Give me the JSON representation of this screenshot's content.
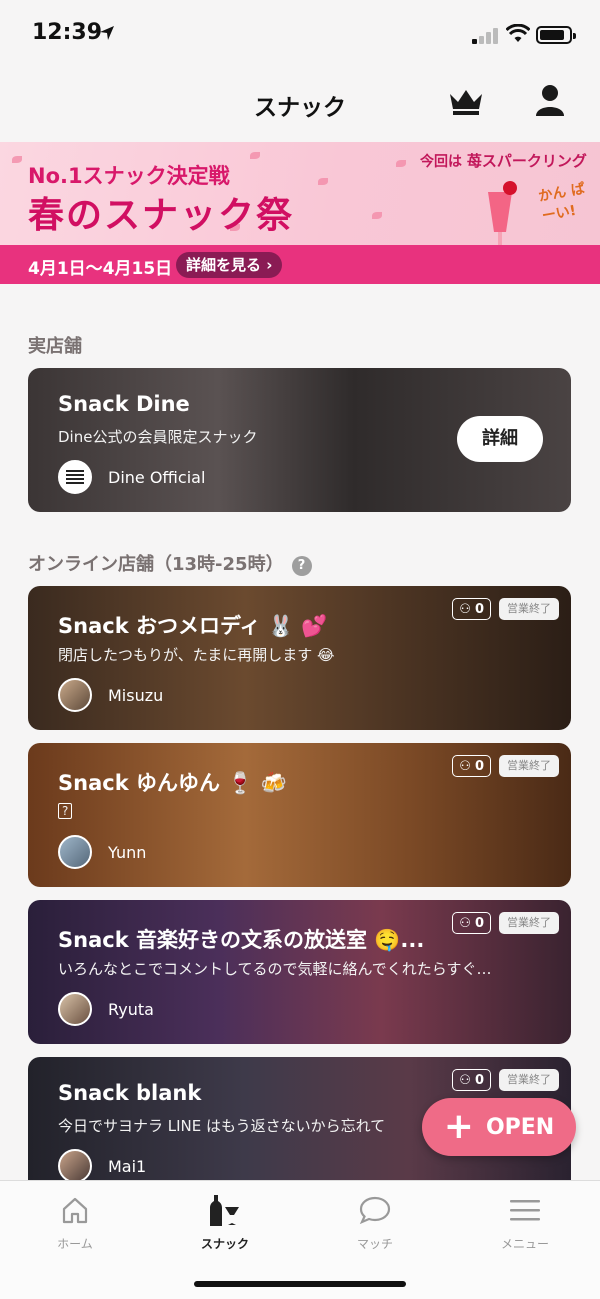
{
  "status_bar": {
    "time": "12:39"
  },
  "nav": {
    "title": "スナック"
  },
  "banner": {
    "subtitle": "No.1スナック決定戦",
    "title": "春のスナック祭",
    "dates": "4月1日〜4月15日",
    "detail_label": "詳細を見る ›",
    "promo_prefix": "今回は",
    "promo_item": "苺スパークリング",
    "kanpai": "かん ぱーい!"
  },
  "physical_section": {
    "label": "実店舗",
    "card": {
      "title": "Snack Dine",
      "description": "Dine公式の会員限定スナック",
      "host": "Dine Official",
      "detail_label": "詳細"
    }
  },
  "online_section": {
    "label": "オンライン店舗（13時-25時）",
    "help_icon": "?",
    "cards": [
      {
        "title": "Snack おつメロディ 🐰 💕",
        "description": "閉店したつもりが、たまに再開します 😂",
        "host": "Misuzu",
        "count": "0",
        "status": "営業終了"
      },
      {
        "title": "Snack ゆんゆん 🍷 🍻",
        "description": "?",
        "host": "Yunn",
        "count": "0",
        "status": "営業終了"
      },
      {
        "title": "Snack 音楽好きの文系の放送室 🤤...",
        "description": "いろんなとこでコメントしてるので気軽に絡んでくれたらすぐ…",
        "host": "Ryuta",
        "count": "0",
        "status": "営業終了"
      },
      {
        "title": "Snack blank",
        "description": "今日でサヨナラ LINE はもう返さないから忘れて",
        "host": "Mai1",
        "count": "0",
        "status": "営業終了"
      }
    ]
  },
  "fab": {
    "label": "OPEN"
  },
  "tabs": [
    {
      "label": "ホーム",
      "icon": "home-icon"
    },
    {
      "label": "スナック",
      "icon": "snack-icon"
    },
    {
      "label": "マッチ",
      "icon": "chat-bubble-icon"
    },
    {
      "label": "メニュー",
      "icon": "menu-icon"
    }
  ],
  "colors": {
    "accent": "#ef6b87",
    "banner_pink": "#e8327e",
    "banner_text": "#d10f62"
  }
}
